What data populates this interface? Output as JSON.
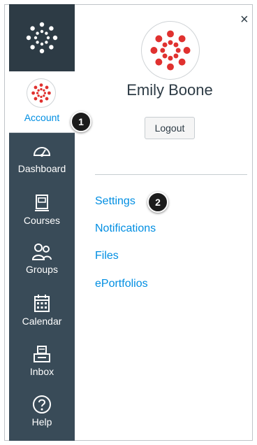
{
  "nav": {
    "account_label": "Account",
    "items": [
      {
        "label": "Dashboard",
        "icon": "dashboard-icon"
      },
      {
        "label": "Courses",
        "icon": "courses-icon"
      },
      {
        "label": "Groups",
        "icon": "groups-icon"
      },
      {
        "label": "Calendar",
        "icon": "calendar-icon"
      },
      {
        "label": "Inbox",
        "icon": "inbox-icon"
      },
      {
        "label": "Help",
        "icon": "help-icon"
      }
    ]
  },
  "callouts": {
    "one": "1",
    "two": "2"
  },
  "tray": {
    "close_symbol": "×",
    "user_name": "Emily Boone",
    "logout_label": "Logout",
    "links": [
      "Settings",
      "Notifications",
      "Files",
      "ePortfolios"
    ]
  },
  "colors": {
    "nav_bg": "#394b58",
    "logo_bg": "#2d3b45",
    "link": "#008ee2",
    "brand_red": "#e0312f"
  }
}
